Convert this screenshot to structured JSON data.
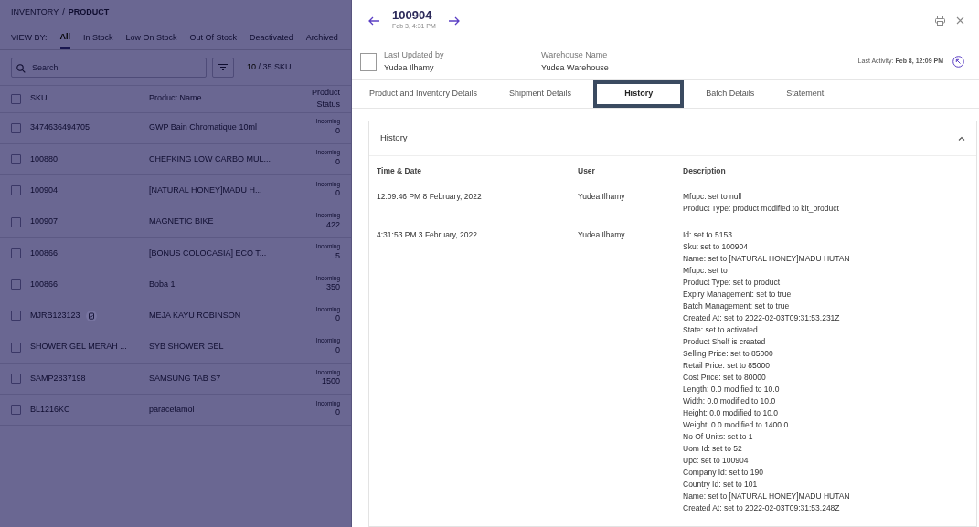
{
  "product_list": {
    "breadcrumb": [
      "INVENTORY",
      "PRODUCT"
    ],
    "breadcrumb_separator": "/",
    "select_all": {
      "checked": false
    },
    "view_by_label": "VIEW BY:",
    "filters": [
      {
        "label": "All",
        "selected": true
      },
      {
        "label": "In Stock",
        "selected": false
      },
      {
        "label": "Low On Stock",
        "selected": false
      },
      {
        "label": "Out Of Stock",
        "selected": false
      },
      {
        "label": "Deactivated",
        "selected": false
      },
      {
        "label": "Archived",
        "selected": false
      }
    ],
    "search": {
      "placeholder": "Search"
    },
    "count": {
      "shown": "10",
      "total": "/ 35 SKU"
    },
    "columns": [
      "SKU",
      "Product Name",
      "Product Status"
    ],
    "rows": [
      {
        "sku": "3474636494705",
        "name": "GWP Bain Chromatique 10ml",
        "status_label": "Incoming",
        "status_value": "0",
        "note_icon": false,
        "checked": false
      },
      {
        "sku": "100880",
        "name": "CHEFKING LOW CARBO MUL...",
        "status_label": "Incoming",
        "status_value": "0",
        "note_icon": false,
        "checked": false
      },
      {
        "sku": "100904",
        "name": "[NATURAL HONEY]MADU H...",
        "status_label": "Incoming",
        "status_value": "0",
        "note_icon": false,
        "checked": false
      },
      {
        "sku": "100907",
        "name": "MAGNETIC BIKE",
        "status_label": "Incoming",
        "status_value": "422",
        "note_icon": false,
        "checked": false
      },
      {
        "sku": "100866",
        "name": "[BONUS COLOCASIA] ECO T...",
        "status_label": "Incoming",
        "status_value": "5",
        "note_icon": false,
        "checked": false
      },
      {
        "sku": "100866",
        "name": "Boba 1",
        "status_label": "Incoming",
        "status_value": "350",
        "note_icon": false,
        "checked": false
      },
      {
        "sku": "MJRB123123",
        "name": "MEJA KAYU ROBINSON",
        "status_label": "Incoming",
        "status_value": "0",
        "note_icon": true,
        "checked": false
      },
      {
        "sku": "SHOWER GEL MERAH ...",
        "name": "SYB SHOWER GEL",
        "status_label": "Incoming",
        "status_value": "0",
        "note_icon": false,
        "checked": false
      },
      {
        "sku": "SAMP2837198",
        "name": "SAMSUNG TAB S7",
        "status_label": "Incoming",
        "status_value": "1500",
        "note_icon": false,
        "checked": false
      },
      {
        "sku": "BL1216KC",
        "name": "paracetamol",
        "status_label": "Incoming",
        "status_value": "0",
        "note_icon": false,
        "checked": false
      }
    ]
  },
  "detail": {
    "title": "100904",
    "subtitle": "Feb 3, 4:31 PM",
    "fields": [
      {
        "label": "Last Updated by",
        "value": "Yudea Ilhamy"
      },
      {
        "label": "Warehouse Name",
        "value": "Yudea Warehouse"
      }
    ],
    "last_activity": "Last Activity: **Feb 8, 12:09 PM**",
    "tabs": [
      {
        "label": "Product and Inventory Details",
        "selected": false
      },
      {
        "label": "Shipment Details",
        "selected": false
      },
      {
        "label": "History",
        "selected": true
      },
      {
        "label": "Batch Details",
        "selected": false
      },
      {
        "label": "Statement",
        "selected": false
      }
    ],
    "history": {
      "title": "History",
      "expanded": true,
      "columns": [
        "Time & Date",
        "User",
        "Description"
      ],
      "rows": [
        {
          "time": "12:09:46 PM 8 February, 2022",
          "user": "Yudea Ilhamy",
          "description": [
            "Mfupc: set to null",
            "Product Type: product modified to kit_product"
          ]
        },
        {
          "time": "4:31:53 PM 3 February, 2022",
          "user": "Yudea Ilhamy",
          "description": [
            "Id: set to 5153",
            "Sku: set to 100904",
            "Name: set to [NATURAL HONEY]MADU HUTAN",
            "Mfupc: set to",
            "Product Type: set to product",
            "Expiry Management: set to true",
            "Batch Management: set to true",
            "Created At: set to 2022-02-03T09:31:53.231Z",
            "State: set to activated",
            "Product Shelf is created",
            "Selling Price: set to 85000",
            "Retail Price: set to 85000",
            "Cost Price: set to 80000",
            "Length: 0.0 modified to 10.0",
            "Width: 0.0 modified to 10.0",
            "Height: 0.0 modified to 10.0",
            "Weight: 0.0 modified to 1400.0",
            "No Of Units: set to 1",
            "Uom Id: set to 52",
            "Upc: set to 100904",
            "Company Id: set to 190",
            "Country Id: set to 101",
            "Name: set to [NATURAL HONEY]MADU HUTAN",
            "Created At: set to 2022-02-03T09:31:53.248Z"
          ]
        }
      ]
    }
  }
}
